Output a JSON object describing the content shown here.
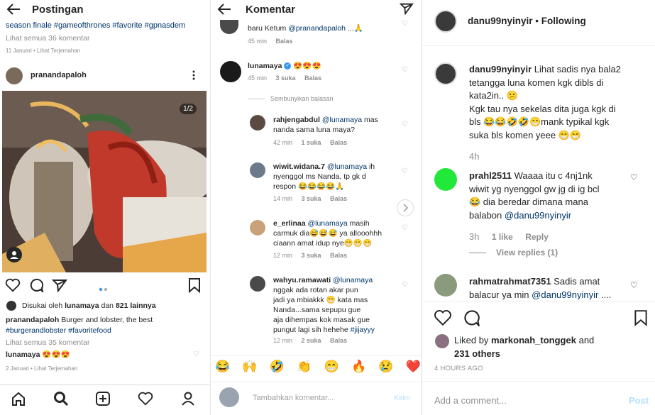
{
  "left": {
    "title": "Postingan",
    "caption_top": "season finale #gameofthrones #favorite #gpnasdem",
    "view_all_top": "Lihat semua 36 komentar",
    "date_top": "11 Januari • Lihat Terjemahan",
    "post_user": "pranandapaloh",
    "image_counter": "1/2",
    "liked_prefix": "Disukai oleh",
    "liked_user": "lunamaya",
    "liked_and": "dan",
    "liked_count": "821 lainnya",
    "caption_user": "pranandapaloh",
    "caption_text": "Burger and lobster, the best",
    "caption_tags": "#burgerandlobster #favoritefood",
    "view_all": "Lihat semua 35 komentar",
    "comment_user": "lunamaya",
    "comment_text": "😍😍😍",
    "date_bottom": "2 Januari • Lihat Terjemahan"
  },
  "middle": {
    "title": "Komentar",
    "first_comment_text": "baru Ketum",
    "first_comment_mention": "@pranandapaloh",
    "first_comment_tail": "...🙏",
    "first_meta_time": "45 min",
    "first_meta_reply": "Balas",
    "luna_user": "lunamaya",
    "luna_text": "😍😍😍",
    "luna_time": "45 min",
    "luna_likes": "3 suka",
    "luna_reply": "Balas",
    "hide_replies": "Sembunyikan balasan",
    "replies": [
      {
        "user": "rahjengabdul",
        "mention": "@lunamaya",
        "text1": "mas",
        "text2": "nanda sama luna maya?",
        "text3": "",
        "time": "42 min",
        "likes": "1 suka",
        "reply": "Balas"
      },
      {
        "user": "wiwit.widana.7",
        "mention": "@lunamaya",
        "text1": "ih",
        "text2": "nyenggol ms Nanda, tp gk d",
        "text3": "respon 😂😂😂😂🙏",
        "time": "14 min",
        "likes": "3 suka",
        "reply": "Balas"
      },
      {
        "user": "e_erlinaa",
        "mention": "@lunamaya",
        "text1": "masih",
        "text2": "carmuk dia😅😅😅 ya allooohhh",
        "text3": "ciaann amat idup nye😁😁😁",
        "time": "12 min",
        "likes": "3 suka",
        "reply": "Balas"
      },
      {
        "user": "wahyu.ramawati",
        "mention": "@lunamaya",
        "text1": "",
        "text2": "nggak ada rotan akar pun",
        "text3": "jadi ya mbiakkk 😁 kata mas",
        "text4": "Nanda...sama sepupu gue",
        "text5": "aja dihempas kok masak gue",
        "text6": "pungut lagi sih hehehe",
        "tag": "#jijayyy",
        "time": "12 min",
        "likes": "2 suka",
        "reply": "Balas"
      }
    ],
    "emojis": [
      "😂",
      "🙌",
      "🤣",
      "👏",
      "😁",
      "🔥",
      "😢",
      "❤️"
    ],
    "input_placeholder": "Tambahkan komentar...",
    "send_label": "Kirim"
  },
  "right": {
    "header_user": "danu99nyinyir",
    "header_sep": "•",
    "header_follow": "Following",
    "caption_user": "danu99nyinyir",
    "caption_l1": "Lihat sadis nya bala2",
    "caption_l2": "tetangga luna komen kgk dibls di",
    "caption_l3": "kata2in.. 😕",
    "caption_l4": "Kgk tau nya sekelas dita juga kgk di",
    "caption_l5": "bls 😂😂🤣🤣😁mank typikal kgk",
    "caption_l6": "suka bls komen yeee 😁😁",
    "caption_time": "4h",
    "c2_user": "prahl2511",
    "c2_l1": "Waaaa itu c 4nj1nk",
    "c2_l2": "wiwit yg nyenggol gw jg di ig bcl",
    "c2_l3": "😂 dia beredar dimana mana",
    "c2_l4_text": "balabon",
    "c2_l4_mention": "@danu99nyinyir",
    "c2_time": "3h",
    "c2_likes": "1 like",
    "c2_reply": "Reply",
    "view_replies": "View replies (1)",
    "c3_user": "rahmatrahmat7351",
    "c3_l1": "Sadis amat",
    "c3_l2_text": "balacur ya min",
    "c3_l2_mention": "@danu99nyinyir",
    "c3_l2_tail": "....",
    "liked_by": "Liked by",
    "liked_user": "markonah_tonggek",
    "liked_and": "and",
    "liked_others": "231 others",
    "time_ago": "4 HOURS AGO",
    "add_comment": "Add a comment...",
    "post_label": "Post"
  },
  "colors": {
    "mention": "#003569",
    "accent_blue": "#3897f0",
    "post_disabled": "#b2dffc",
    "verified": "#3897f0",
    "green_avatar": "#22e83a"
  }
}
